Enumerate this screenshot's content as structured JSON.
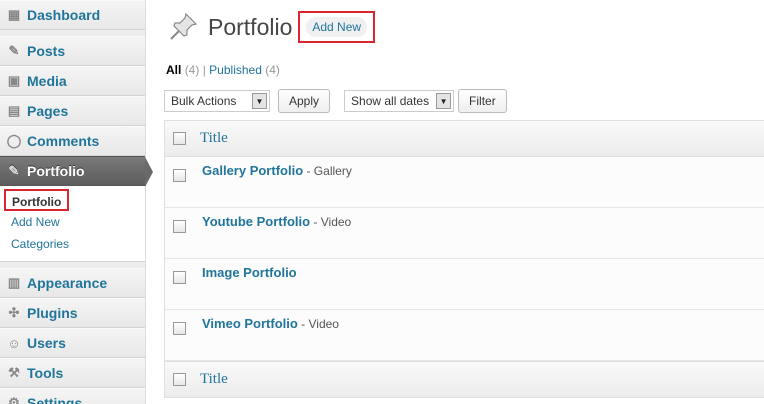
{
  "sidebar": {
    "top_items": [
      {
        "label": "Dashboard",
        "icon": "dashboard-icon"
      },
      {
        "label": "Posts",
        "icon": "pushpin-icon"
      },
      {
        "label": "Media",
        "icon": "media-icon"
      },
      {
        "label": "Pages",
        "icon": "pages-icon"
      },
      {
        "label": "Comments",
        "icon": "comment-icon"
      },
      {
        "label": "Portfolio",
        "icon": "pushpin-icon"
      }
    ],
    "submenu": [
      {
        "label": "Portfolio"
      },
      {
        "label": "Add New"
      },
      {
        "label": "Categories"
      }
    ],
    "bottom_items": [
      {
        "label": "Appearance",
        "icon": "appearance-icon"
      },
      {
        "label": "Plugins",
        "icon": "plugin-icon"
      },
      {
        "label": "Users",
        "icon": "users-icon"
      },
      {
        "label": "Tools",
        "icon": "tools-icon"
      },
      {
        "label": "Settings",
        "icon": "settings-icon"
      }
    ]
  },
  "header": {
    "title": "Portfolio",
    "add_new_label": "Add New"
  },
  "filters": {
    "all_label": "All",
    "all_count": "(4)",
    "separator": "|",
    "published_label": "Published",
    "published_count": "(4)"
  },
  "actions": {
    "bulk_select": "Bulk Actions",
    "apply_label": "Apply",
    "date_select": "Show all dates",
    "filter_label": "Filter"
  },
  "table": {
    "column_title": "Title",
    "rows": [
      {
        "title": "Gallery Portfolio",
        "category": " - Gallery"
      },
      {
        "title": "Youtube Portfolio",
        "category": " - Video"
      },
      {
        "title": "Image Portfolio",
        "category": ""
      },
      {
        "title": "Vimeo Portfolio",
        "category": " - Video"
      }
    ]
  },
  "colors": {
    "link": "#21759b",
    "highlight_border": "#d8262e",
    "current_menu_bg": "#666666"
  }
}
